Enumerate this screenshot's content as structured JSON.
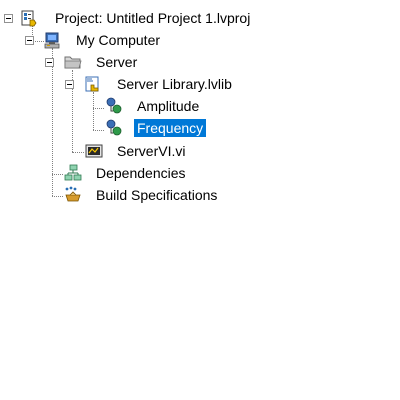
{
  "tree": {
    "project": {
      "label": "Project: Untitled Project 1.lvproj",
      "icon": "labview-project-icon"
    },
    "computer": {
      "label": "My Computer",
      "icon": "computer-icon"
    },
    "server": {
      "label": "Server",
      "icon": "folder-icon"
    },
    "library": {
      "label": "Server Library.lvlib",
      "icon": "library-icon"
    },
    "amplitude": {
      "label": "Amplitude",
      "icon": "shared-variable-icon"
    },
    "frequency": {
      "label": "Frequency",
      "icon": "shared-variable-icon",
      "selected": true
    },
    "servervi": {
      "label": "ServerVI.vi",
      "icon": "vi-icon"
    },
    "dependencies": {
      "label": "Dependencies",
      "icon": "dependencies-icon"
    },
    "build": {
      "label": "Build Specifications",
      "icon": "build-specifications-icon"
    }
  },
  "colors": {
    "selection": "#0078d7",
    "tree_line": "#808080"
  }
}
